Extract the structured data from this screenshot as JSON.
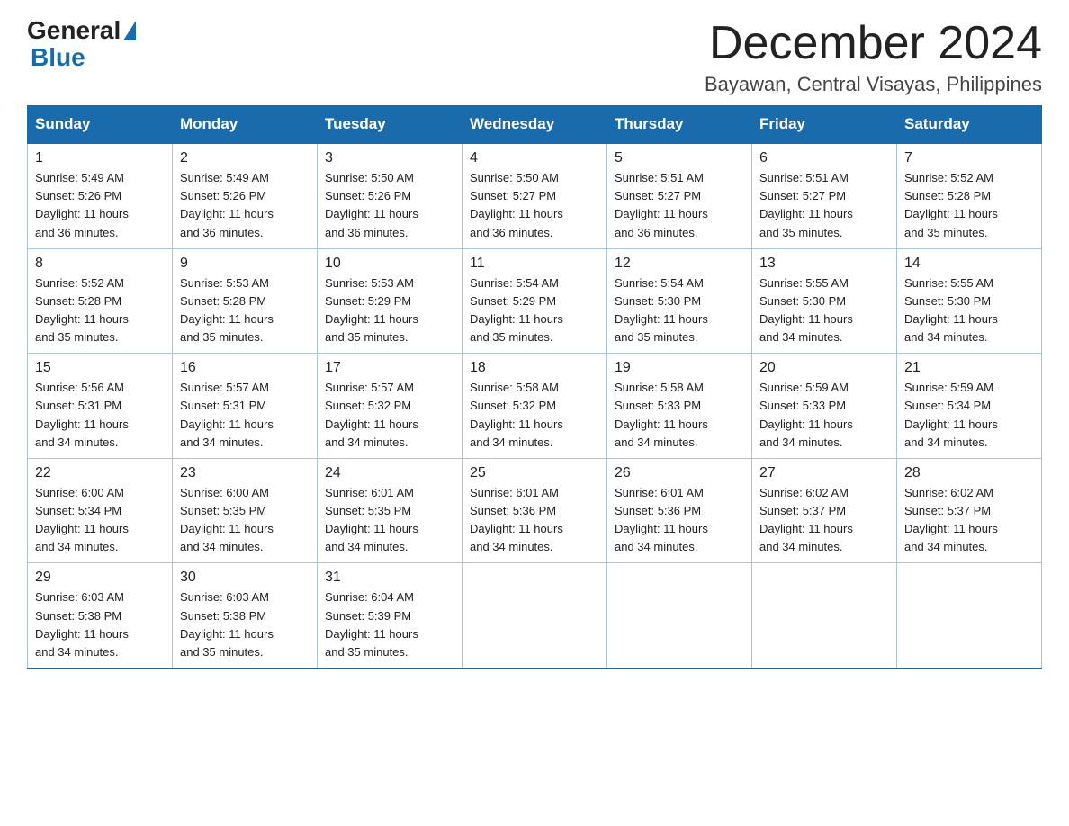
{
  "header": {
    "logo_general": "General",
    "logo_blue": "Blue",
    "month_title": "December 2024",
    "location": "Bayawan, Central Visayas, Philippines"
  },
  "days_of_week": [
    "Sunday",
    "Monday",
    "Tuesday",
    "Wednesday",
    "Thursday",
    "Friday",
    "Saturday"
  ],
  "weeks": [
    [
      {
        "day": "1",
        "sunrise": "5:49 AM",
        "sunset": "5:26 PM",
        "daylight": "11 hours and 36 minutes."
      },
      {
        "day": "2",
        "sunrise": "5:49 AM",
        "sunset": "5:26 PM",
        "daylight": "11 hours and 36 minutes."
      },
      {
        "day": "3",
        "sunrise": "5:50 AM",
        "sunset": "5:26 PM",
        "daylight": "11 hours and 36 minutes."
      },
      {
        "day": "4",
        "sunrise": "5:50 AM",
        "sunset": "5:27 PM",
        "daylight": "11 hours and 36 minutes."
      },
      {
        "day": "5",
        "sunrise": "5:51 AM",
        "sunset": "5:27 PM",
        "daylight": "11 hours and 36 minutes."
      },
      {
        "day": "6",
        "sunrise": "5:51 AM",
        "sunset": "5:27 PM",
        "daylight": "11 hours and 35 minutes."
      },
      {
        "day": "7",
        "sunrise": "5:52 AM",
        "sunset": "5:28 PM",
        "daylight": "11 hours and 35 minutes."
      }
    ],
    [
      {
        "day": "8",
        "sunrise": "5:52 AM",
        "sunset": "5:28 PM",
        "daylight": "11 hours and 35 minutes."
      },
      {
        "day": "9",
        "sunrise": "5:53 AM",
        "sunset": "5:28 PM",
        "daylight": "11 hours and 35 minutes."
      },
      {
        "day": "10",
        "sunrise": "5:53 AM",
        "sunset": "5:29 PM",
        "daylight": "11 hours and 35 minutes."
      },
      {
        "day": "11",
        "sunrise": "5:54 AM",
        "sunset": "5:29 PM",
        "daylight": "11 hours and 35 minutes."
      },
      {
        "day": "12",
        "sunrise": "5:54 AM",
        "sunset": "5:30 PM",
        "daylight": "11 hours and 35 minutes."
      },
      {
        "day": "13",
        "sunrise": "5:55 AM",
        "sunset": "5:30 PM",
        "daylight": "11 hours and 34 minutes."
      },
      {
        "day": "14",
        "sunrise": "5:55 AM",
        "sunset": "5:30 PM",
        "daylight": "11 hours and 34 minutes."
      }
    ],
    [
      {
        "day": "15",
        "sunrise": "5:56 AM",
        "sunset": "5:31 PM",
        "daylight": "11 hours and 34 minutes."
      },
      {
        "day": "16",
        "sunrise": "5:57 AM",
        "sunset": "5:31 PM",
        "daylight": "11 hours and 34 minutes."
      },
      {
        "day": "17",
        "sunrise": "5:57 AM",
        "sunset": "5:32 PM",
        "daylight": "11 hours and 34 minutes."
      },
      {
        "day": "18",
        "sunrise": "5:58 AM",
        "sunset": "5:32 PM",
        "daylight": "11 hours and 34 minutes."
      },
      {
        "day": "19",
        "sunrise": "5:58 AM",
        "sunset": "5:33 PM",
        "daylight": "11 hours and 34 minutes."
      },
      {
        "day": "20",
        "sunrise": "5:59 AM",
        "sunset": "5:33 PM",
        "daylight": "11 hours and 34 minutes."
      },
      {
        "day": "21",
        "sunrise": "5:59 AM",
        "sunset": "5:34 PM",
        "daylight": "11 hours and 34 minutes."
      }
    ],
    [
      {
        "day": "22",
        "sunrise": "6:00 AM",
        "sunset": "5:34 PM",
        "daylight": "11 hours and 34 minutes."
      },
      {
        "day": "23",
        "sunrise": "6:00 AM",
        "sunset": "5:35 PM",
        "daylight": "11 hours and 34 minutes."
      },
      {
        "day": "24",
        "sunrise": "6:01 AM",
        "sunset": "5:35 PM",
        "daylight": "11 hours and 34 minutes."
      },
      {
        "day": "25",
        "sunrise": "6:01 AM",
        "sunset": "5:36 PM",
        "daylight": "11 hours and 34 minutes."
      },
      {
        "day": "26",
        "sunrise": "6:01 AM",
        "sunset": "5:36 PM",
        "daylight": "11 hours and 34 minutes."
      },
      {
        "day": "27",
        "sunrise": "6:02 AM",
        "sunset": "5:37 PM",
        "daylight": "11 hours and 34 minutes."
      },
      {
        "day": "28",
        "sunrise": "6:02 AM",
        "sunset": "5:37 PM",
        "daylight": "11 hours and 34 minutes."
      }
    ],
    [
      {
        "day": "29",
        "sunrise": "6:03 AM",
        "sunset": "5:38 PM",
        "daylight": "11 hours and 34 minutes."
      },
      {
        "day": "30",
        "sunrise": "6:03 AM",
        "sunset": "5:38 PM",
        "daylight": "11 hours and 35 minutes."
      },
      {
        "day": "31",
        "sunrise": "6:04 AM",
        "sunset": "5:39 PM",
        "daylight": "11 hours and 35 minutes."
      },
      null,
      null,
      null,
      null
    ]
  ],
  "labels": {
    "sunrise": "Sunrise:",
    "sunset": "Sunset:",
    "daylight": "Daylight:"
  }
}
